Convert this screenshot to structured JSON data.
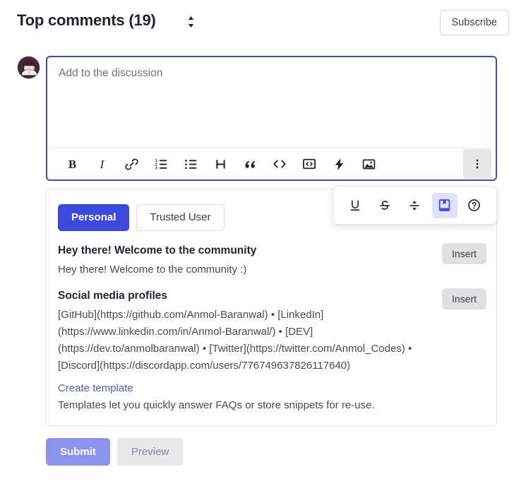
{
  "header": {
    "title": "Top comments (19)",
    "sort_icon": "chevron-up-down-icon",
    "subscribe_label": "Subscribe"
  },
  "composer": {
    "avatar_alt": "user-avatar",
    "placeholder": "Add to the discussion",
    "value": "",
    "toolbar": [
      {
        "name": "bold-icon",
        "label": "B"
      },
      {
        "name": "italic-icon",
        "label": "I"
      },
      {
        "name": "link-icon",
        "label": "Link"
      },
      {
        "name": "ordered-list-icon",
        "label": "Ordered list"
      },
      {
        "name": "unordered-list-icon",
        "label": "Unordered list"
      },
      {
        "name": "heading-icon",
        "label": "H"
      },
      {
        "name": "quote-icon",
        "label": "Quote"
      },
      {
        "name": "code-icon",
        "label": "Code"
      },
      {
        "name": "code-block-icon",
        "label": "Code block"
      },
      {
        "name": "embed-icon",
        "label": "Embed"
      },
      {
        "name": "image-icon",
        "label": "Image"
      }
    ],
    "overflow_label": "More options",
    "overflow_menu": [
      {
        "name": "underline-icon",
        "label": "Underline",
        "active": false
      },
      {
        "name": "strikethrough-icon",
        "label": "Strikethrough",
        "active": false
      },
      {
        "name": "line-divider-icon",
        "label": "Line divider",
        "active": false
      },
      {
        "name": "template-icon",
        "label": "Templates",
        "active": true
      },
      {
        "name": "help-icon",
        "label": "Help",
        "active": false
      }
    ]
  },
  "templates": {
    "tabs": [
      {
        "label": "Personal",
        "active": true
      },
      {
        "label": "Trusted User",
        "active": false
      }
    ],
    "items": [
      {
        "title": "Hey there! Welcome to the community",
        "body": "Hey there! Welcome to the community :)",
        "insert_label": "Insert"
      },
      {
        "title": "Social media profiles",
        "body": "[GitHub](https://github.com/Anmol-Baranwal) • [LinkedIn](https://www.linkedin.com/in/Anmol-Baranwal/) • [DEV](https://dev.to/anmolbaranwal) • [Twitter](https://twitter.com/Anmol_Codes) • [Discord](https://discordapp.com/users/776749637826117640)",
        "insert_label": "Insert"
      }
    ],
    "create_link": "Create template",
    "create_description": "Templates let you quickly answer FAQs or store snippets for re-use."
  },
  "footer": {
    "submit_label": "Submit",
    "preview_label": "Preview"
  },
  "colors": {
    "accent": "#3b49df",
    "accent_muted": "#8c93ef",
    "link": "#4a5bf0",
    "menu_active_bg": "#e0e2fb",
    "neutral_button": "#e0e0e2"
  }
}
